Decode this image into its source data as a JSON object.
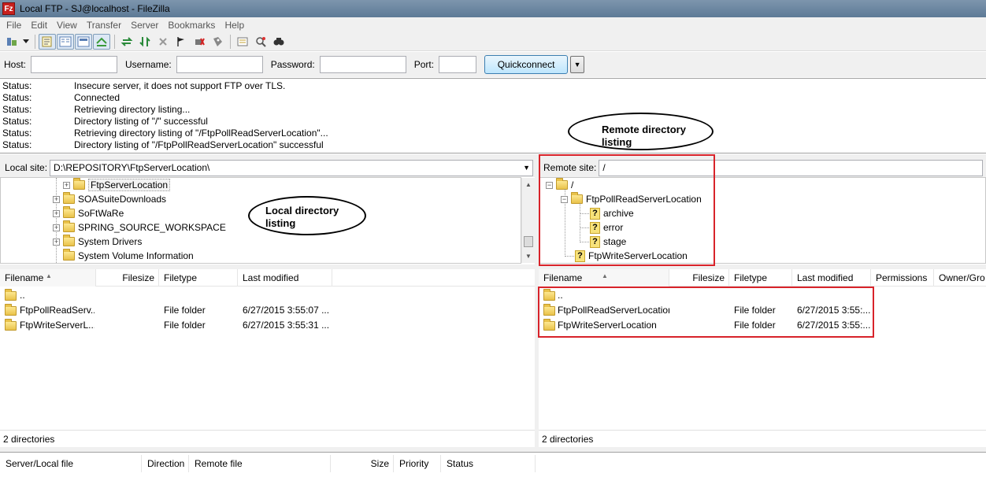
{
  "window": {
    "title": "Local FTP - SJ@localhost - FileZilla",
    "app_icon": "filezilla-icon",
    "accent_color": "#d8232a"
  },
  "menu": [
    "File",
    "Edit",
    "View",
    "Transfer",
    "Server",
    "Bookmarks",
    "Help"
  ],
  "toolbar": {
    "icons": [
      "site-manager-icon",
      "dropdown-arrow-icon",
      "toggle-message-log-icon",
      "toggle-local-tree-icon",
      "toggle-remote-tree-icon",
      "toggle-queue-icon",
      "refresh-icon",
      "process-queue-icon",
      "cancel-icon",
      "disconnect-icon",
      "reconnect-icon",
      "directory-filter-icon",
      "compare-icon",
      "sync-browse-icon",
      "search-icon"
    ]
  },
  "quickconnect": {
    "host_label": "Host:",
    "host_value": "",
    "username_label": "Username:",
    "username_value": "",
    "password_label": "Password:",
    "password_value": "",
    "port_label": "Port:",
    "port_value": "",
    "button_label": "Quickconnect",
    "dropdown_glyph": "▼"
  },
  "log": [
    {
      "type": "Status:",
      "message": "Insecure server, it does not support FTP over TLS."
    },
    {
      "type": "Status:",
      "message": "Connected"
    },
    {
      "type": "Status:",
      "message": "Retrieving directory listing..."
    },
    {
      "type": "Status:",
      "message": "Directory listing of \"/\" successful"
    },
    {
      "type": "Status:",
      "message": "Retrieving directory listing of \"/FtpPollReadServerLocation\"..."
    },
    {
      "type": "Status:",
      "message": "Directory listing of \"/FtpPollReadServerLocation\" successful"
    }
  ],
  "local": {
    "site_label": "Local site:",
    "path": "D:\\REPOSITORY\\FtpServerLocation\\",
    "tree": [
      "FtpServerLocation",
      "SOASuiteDownloads",
      "SoFtWaRe",
      "SPRING_SOURCE_WORKSPACE",
      "System Drivers",
      "System Volume Information"
    ],
    "columns": [
      "Filename",
      "Filesize",
      "Filetype",
      "Last modified"
    ],
    "files": [
      {
        "name": "..",
        "size": "",
        "type": "",
        "modified": ""
      },
      {
        "name": "FtpPollReadServ...",
        "size": "",
        "type": "File folder",
        "modified": "6/27/2015 3:55:07 ..."
      },
      {
        "name": "FtpWriteServerL...",
        "size": "",
        "type": "File folder",
        "modified": "6/27/2015 3:55:31 ..."
      }
    ],
    "status": "2 directories"
  },
  "remote": {
    "site_label": "Remote site:",
    "path": "/",
    "tree": [
      "/",
      "FtpPollReadServerLocation",
      "archive",
      "error",
      "stage",
      "FtpWriteServerLocation"
    ],
    "columns": [
      "Filename",
      "Filesize",
      "Filetype",
      "Last modified",
      "Permissions",
      "Owner/Gro"
    ],
    "files": [
      {
        "name": "..",
        "size": "",
        "type": "",
        "modified": ""
      },
      {
        "name": "FtpPollReadServerLocation",
        "size": "",
        "type": "File folder",
        "modified": "6/27/2015 3:55:..."
      },
      {
        "name": "FtpWriteServerLocation",
        "size": "",
        "type": "File folder",
        "modified": "6/27/2015 3:55:..."
      }
    ],
    "status": "2 directories"
  },
  "queue": {
    "columns": [
      "Server/Local file",
      "Direction",
      "Remote file",
      "Size",
      "Priority",
      "Status"
    ]
  },
  "annotations": {
    "remote_label_line1": "Remote directory",
    "remote_label_line2": "listing",
    "local_label_line1": "Local directory",
    "local_label_line2": "listing"
  }
}
